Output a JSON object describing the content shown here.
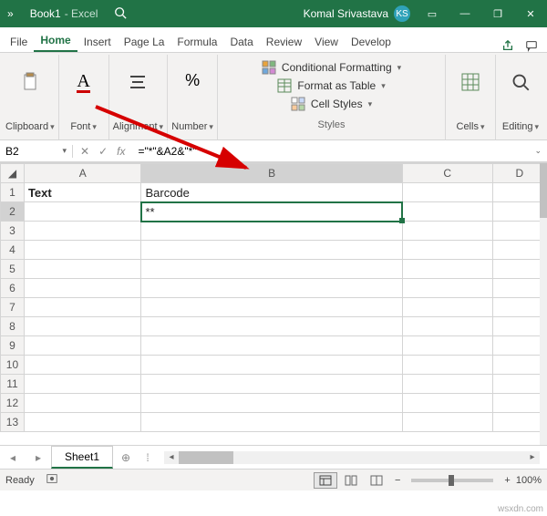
{
  "title": {
    "overflow_icon": "»",
    "doc": "Book1",
    "app": "- Excel",
    "user": "Komal Srivastava",
    "initials": "KS"
  },
  "window_icons": {
    "ribbon_mode": "▭",
    "min": "—",
    "restore": "❐",
    "close": "✕"
  },
  "tabs": {
    "file": "File",
    "home": "Home",
    "insert": "Insert",
    "pagelayout": "Page La",
    "formulas": "Formula",
    "data": "Data",
    "review": "Review",
    "view": "View",
    "developer": "Develop"
  },
  "ribbon": {
    "clipboard": "Clipboard",
    "font": "Font",
    "alignment": "Alignment",
    "number": "Number",
    "cond_fmt": "Conditional Formatting",
    "fmt_table": "Format as Table",
    "cell_styles": "Cell Styles",
    "styles": "Styles",
    "cells": "Cells",
    "editing": "Editing"
  },
  "namebox": "B2",
  "fx": {
    "cancel": "✕",
    "enter": "✓",
    "fx": "fx"
  },
  "formula": "=\"*\"&A2&\"*\"",
  "columns": [
    "A",
    "B",
    "C",
    "D"
  ],
  "rows": [
    "1",
    "2",
    "3",
    "4",
    "5",
    "6",
    "7",
    "8",
    "9",
    "10",
    "11",
    "12",
    "13"
  ],
  "cells": {
    "A1": "Text",
    "B1": "Barcode",
    "B2": "**"
  },
  "sheet": {
    "name": "Sheet1",
    "add": "⊕"
  },
  "status": {
    "ready": "Ready",
    "zoom": "100%",
    "zoom_out": "−",
    "zoom_in": "+"
  },
  "watermark": "wsxdn.com"
}
